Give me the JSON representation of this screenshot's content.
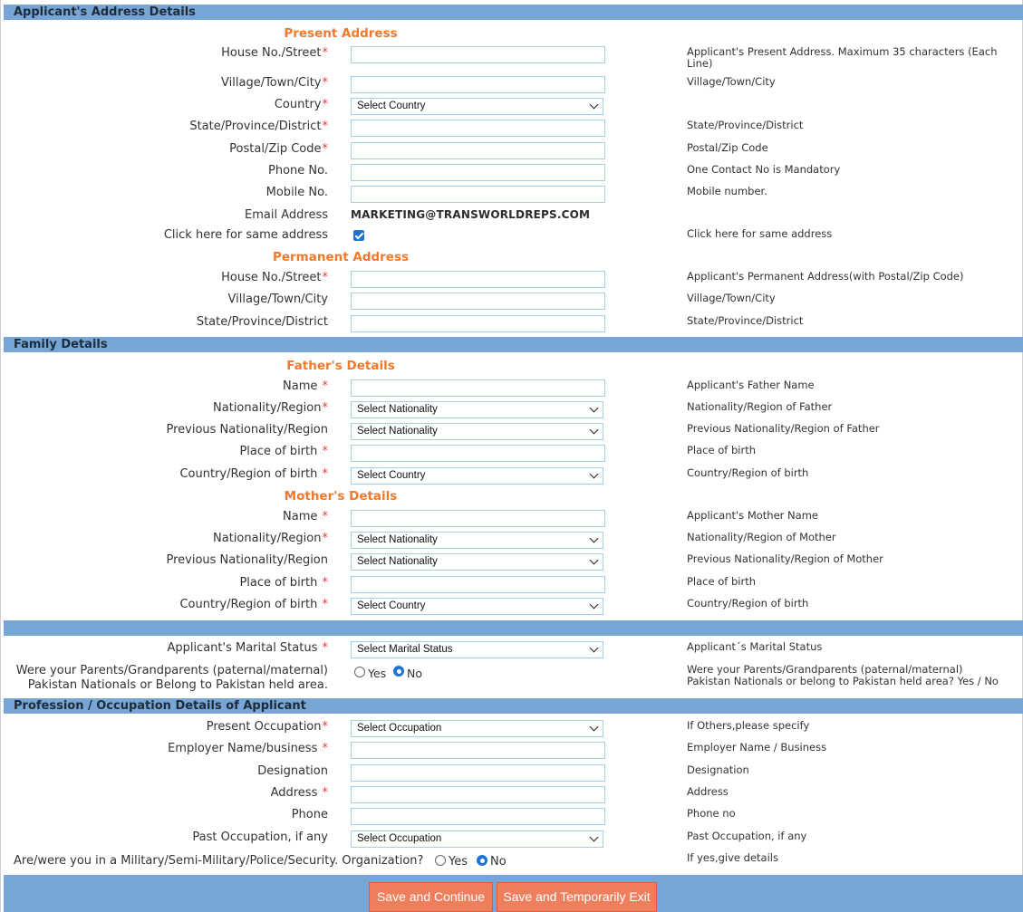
{
  "address": {
    "band_title": "Applicant's Address Details",
    "present_heading": "Present Address",
    "present": {
      "house_street": {
        "label": "House No./Street",
        "value": "",
        "hint": "Applicant's Present Address. Maximum 35 characters (Each Line)"
      },
      "village_city": {
        "label": "Village/Town/City",
        "value": "",
        "hint": "Village/Town/City"
      },
      "country": {
        "label": "Country",
        "selected": "Select Country"
      },
      "state": {
        "label": "State/Province/District",
        "value": "",
        "hint": "State/Province/District"
      },
      "postal": {
        "label": "Postal/Zip Code",
        "value": "",
        "hint": "Postal/Zip Code"
      },
      "phone": {
        "label": "Phone No.",
        "value": "",
        "hint": "One Contact No is Mandatory"
      },
      "mobile": {
        "label": "Mobile No.",
        "value": "",
        "hint": "Mobile number."
      },
      "email": {
        "label": "Email Address",
        "value": "MARKETING@TRANSWORLDREPS.COM"
      },
      "same_address": {
        "label": "Click here for same address",
        "checked": true,
        "hint": "Click here for same address"
      }
    },
    "permanent_heading": "Permanent Address",
    "permanent": {
      "house_street": {
        "label": "House No./Street",
        "value": "",
        "hint": "Applicant's Permanent Address(with Postal/Zip Code)"
      },
      "village_city": {
        "label": "Village/Town/City",
        "value": "",
        "hint": "Village/Town/City"
      },
      "state": {
        "label": "State/Province/District",
        "value": "",
        "hint": "State/Province/District"
      }
    }
  },
  "family": {
    "band_title": "Family Details",
    "father_heading": "Father's Details",
    "father": {
      "name": {
        "label": "Name",
        "value": "",
        "hint": "Applicant's Father Name"
      },
      "nationality": {
        "label": "Nationality/Region",
        "selected": "Select Nationality",
        "hint": "Nationality/Region of Father"
      },
      "prev_nationality": {
        "label": "Previous Nationality/Region",
        "selected": "Select Nationality",
        "hint": "Previous Nationality/Region of Father"
      },
      "place_of_birth": {
        "label": "Place of birth",
        "value": "",
        "hint": "Place of birth"
      },
      "country_of_birth": {
        "label": "Country/Region of birth",
        "selected": "Select Country",
        "hint": "Country/Region of birth"
      }
    },
    "mother_heading": "Mother's Details",
    "mother": {
      "name": {
        "label": "Name",
        "value": "",
        "hint": "Applicant's Mother Name"
      },
      "nationality": {
        "label": "Nationality/Region",
        "selected": "Select Nationality",
        "hint": "Nationality/Region of Mother"
      },
      "prev_nationality": {
        "label": "Previous Nationality/Region",
        "selected": "Select Nationality",
        "hint": "Previous Nationality/Region of Mother"
      },
      "place_of_birth": {
        "label": "Place of birth",
        "value": "",
        "hint": "Place of birth"
      },
      "country_of_birth": {
        "label": "Country/Region of birth",
        "selected": "Select Country",
        "hint": "Country/Region of birth"
      }
    }
  },
  "marital": {
    "label": "Applicant's Marital Status",
    "selected": "Select Marital Status",
    "hint": "Applicant´s Marital Status"
  },
  "parents_pakistan": {
    "label": "Were your Parents/Grandparents (paternal/maternal) Pakistan Nationals or Belong to Pakistan held area.",
    "yes_label": "Yes",
    "no_label": "No",
    "selected": "No",
    "hint": "Were your Parents/Grandparents (paternal/maternal) Pakistan Nationals or belong to Pakistan held area? Yes / No"
  },
  "profession": {
    "band_title": "Profession / Occupation Details of Applicant",
    "present_occupation": {
      "label": "Present Occupation",
      "selected": "Select Occupation",
      "hint": "If Others,please specify"
    },
    "employer": {
      "label": "Employer Name/business",
      "value": "",
      "hint": "Employer Name / Business"
    },
    "designation": {
      "label": "Designation",
      "value": "",
      "hint": "Designation"
    },
    "address": {
      "label": "Address",
      "value": "",
      "hint": "Address"
    },
    "phone": {
      "label": "Phone",
      "value": "",
      "hint": "Phone no"
    },
    "past_occupation": {
      "label": "Past Occupation, if any",
      "selected": "Select Occupation",
      "hint": "Past Occupation, if any"
    },
    "military": {
      "label": "Are/were you in a Military/Semi-Military/Police/Security. Organization?",
      "yes_label": "Yes",
      "no_label": "No",
      "selected": "No",
      "hint": "If yes,give details"
    }
  },
  "actions": {
    "save_continue": "Save and Continue",
    "save_exit": "Save and Temporarily Exit"
  },
  "required_mark": "*",
  "colors": {
    "band": "#77a6d6",
    "subheading": "#f0792c",
    "required": "#e53935",
    "button": "#ef7e5d",
    "input_border": "#9fd0f0"
  }
}
